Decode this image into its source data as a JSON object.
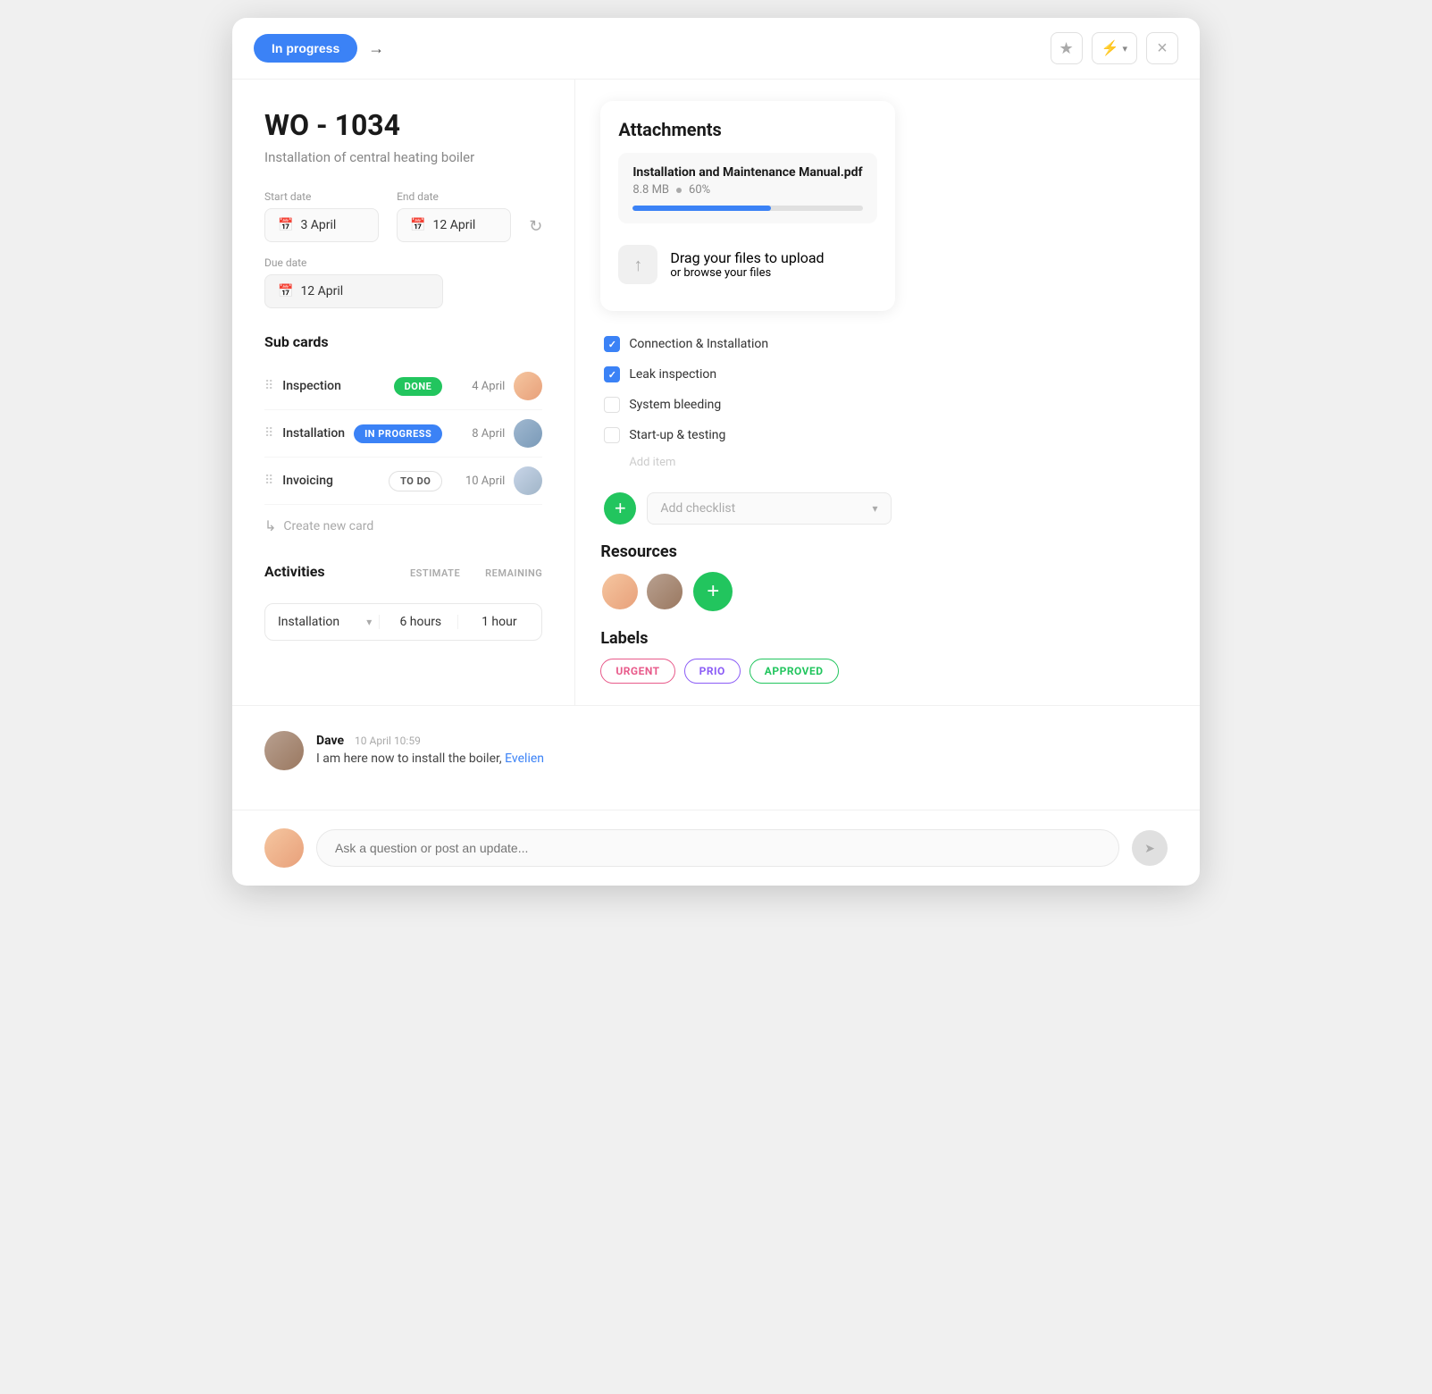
{
  "modal": {
    "status_label": "In progress",
    "title": "WO - 1034",
    "subtitle": "Installation of central heating boiler",
    "start_date_label": "Start date",
    "end_date_label": "End date",
    "start_date": "3 April",
    "end_date": "12 April",
    "due_date_label": "Due date",
    "due_date": "12 April"
  },
  "sub_cards": {
    "title": "Sub cards",
    "items": [
      {
        "name": "Inspection",
        "badge": "DONE",
        "badge_type": "done",
        "date": "4 April",
        "avatar": "f"
      },
      {
        "name": "Installation",
        "badge": "IN PROGRESS",
        "badge_type": "inprogress",
        "date": "8 April",
        "avatar": "m"
      },
      {
        "name": "Invoicing",
        "badge": "TO DO",
        "badge_type": "todo",
        "date": "10 April",
        "avatar": "f2"
      }
    ],
    "create_label": "Create new card"
  },
  "activities": {
    "title": "Activities",
    "col_estimate": "ESTIMATE",
    "col_remaining": "REMAINING",
    "rows": [
      {
        "name": "Installation",
        "estimate": "6 hours",
        "remaining": "1 hour"
      }
    ]
  },
  "attachments": {
    "title": "Attachments",
    "files": [
      {
        "name": "Installation and Maintenance Manual.pdf",
        "size": "8.8 MB",
        "progress_pct": 60,
        "progress_label": "60%"
      }
    ],
    "upload_text1": "Drag your files to upload",
    "upload_text2": "or browse your files"
  },
  "checklist": {
    "items": [
      {
        "label": "Connection & Installation",
        "checked": true
      },
      {
        "label": "Leak inspection",
        "checked": true
      },
      {
        "label": "System bleeding",
        "checked": false
      },
      {
        "label": "Start-up & testing",
        "checked": false
      }
    ],
    "add_item_label": "Add item",
    "add_checklist_placeholder": "Add checklist",
    "add_checklist_chevron": "▾"
  },
  "resources": {
    "title": "Resources"
  },
  "labels": {
    "title": "Labels",
    "items": [
      {
        "text": "URGENT",
        "type": "urgent"
      },
      {
        "text": "PRIO",
        "type": "prio"
      },
      {
        "text": "APPROVED",
        "type": "approved"
      }
    ]
  },
  "comments": {
    "items": [
      {
        "author": "Dave",
        "time": "10 April 10:59",
        "text": "I am here now to install the boiler, ",
        "mention": "Evelien",
        "avatar": "m"
      }
    ],
    "input_placeholder": "Ask a question or post an update..."
  },
  "icons": {
    "star": "★",
    "flash": "⚡",
    "close": "×",
    "arrow_right": "→",
    "calendar": "📅",
    "refresh": "↻",
    "chevron_down": "▾",
    "drag": "⠿",
    "link_arrow": "↳",
    "upload": "↑",
    "send": "➤"
  }
}
